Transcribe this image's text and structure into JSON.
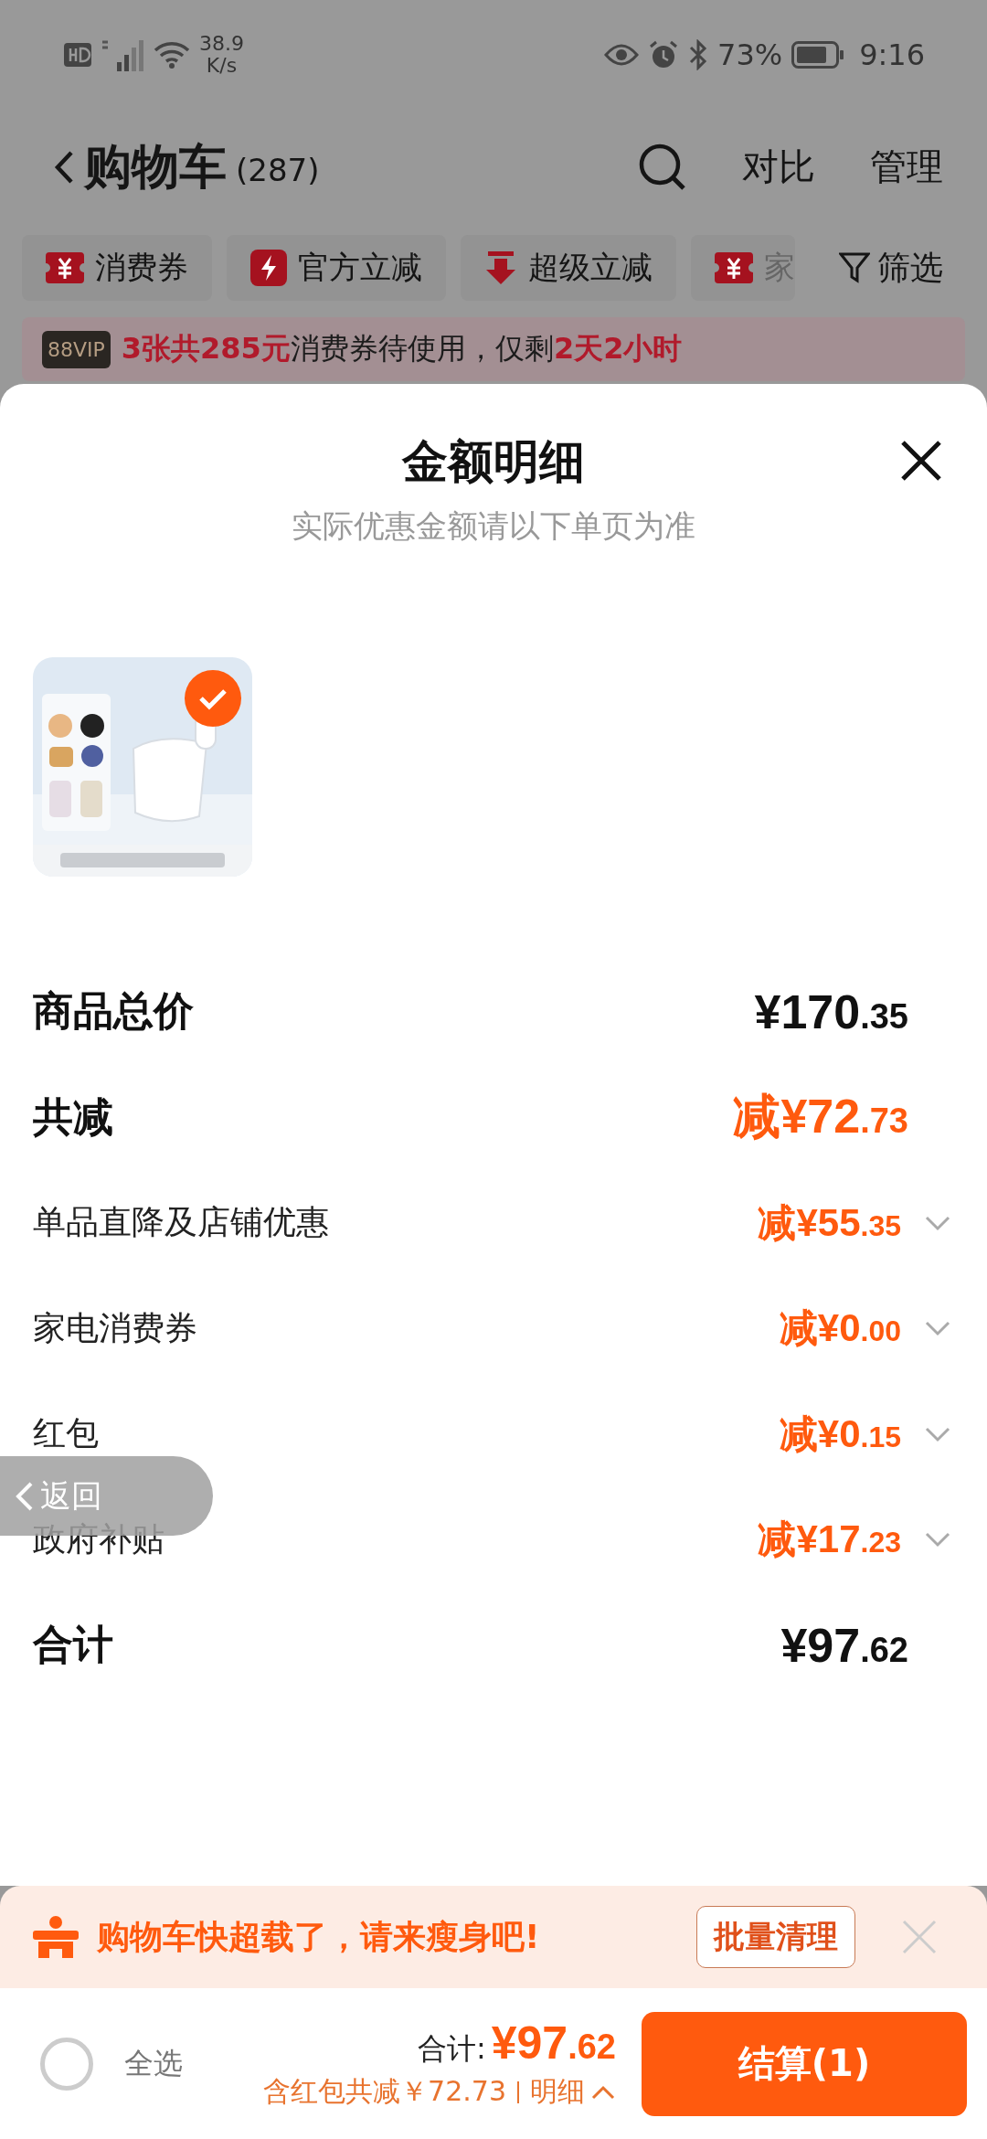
{
  "status_bar": {
    "network_speed": "38.9",
    "speed_unit": "K/s",
    "battery": "73%",
    "time": "9:16"
  },
  "header": {
    "title": "购物车",
    "count": "(287)",
    "actions": [
      "对比",
      "管理"
    ]
  },
  "filter_chips": [
    {
      "label": "消费券",
      "kind": "coupon"
    },
    {
      "label": "官方立减",
      "kind": "flash"
    },
    {
      "label": "超级立减",
      "kind": "down"
    },
    {
      "label": "家",
      "kind": "coupon"
    }
  ],
  "filter_button": "筛选",
  "vip_banner": {
    "badge": "88VIP",
    "message": "**3张共285元**消费券待使用，仅剩**2天2小时**"
  },
  "sheet": {
    "title": "金额明细",
    "subtitle": "实际优惠金额请以下单页为准",
    "products": [
      {
        "kind": "picture",
        "selected": true
      }
    ],
    "rows": [
      {
        "kind": "total",
        "label": "商品总价",
        "amount": "¥170.35"
      },
      {
        "kind": "discount",
        "label": "共减",
        "amount": "减¥72.73"
      },
      {
        "kind": "detail",
        "label": "单品直降及店铺优惠",
        "amount": "减¥55.35",
        "expanded": false
      },
      {
        "kind": "detail",
        "label": "家电消费券",
        "amount": "减¥0.00",
        "expanded": false
      },
      {
        "kind": "detail",
        "label": "红包",
        "amount": "减¥0.15",
        "expanded": false
      },
      {
        "kind": "detail",
        "label": "政府补贴",
        "amount": "减¥17.23",
        "expanded": false
      },
      {
        "kind": "total",
        "label": "合计",
        "amount": "¥97.62"
      }
    ]
  },
  "back_pill": "返回",
  "overload_banner": {
    "message": "购物车快超载了，请来瘦身吧!",
    "button": "批量清理"
  },
  "checkout": {
    "select_all": {
      "label": "全选",
      "checked": false
    },
    "total_label": "合计:",
    "total": "¥97.62",
    "savings": "含红包共减￥72.73",
    "details": "明细",
    "details_expanded": true,
    "button": "结算(1)"
  }
}
